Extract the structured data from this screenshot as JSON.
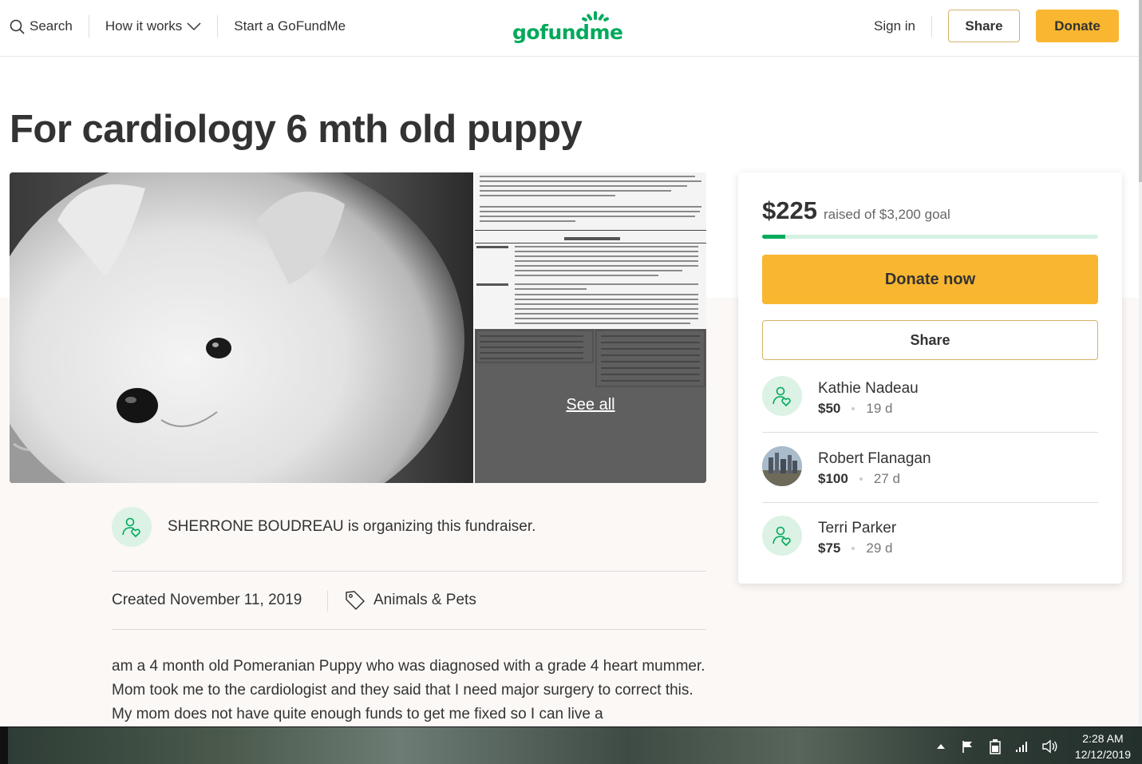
{
  "header": {
    "search_label": "Search",
    "how_it_works_label": "How it works",
    "start_label": "Start a GoFundMe",
    "logo_text": "gofundme",
    "sign_in_label": "Sign in",
    "share_label": "Share",
    "donate_label": "Donate"
  },
  "campaign": {
    "title": "For cardiology 6 mth old puppy",
    "see_all_label": "See all",
    "organizer_text": "SHERRONE BOUDREAU is organizing this fundraiser.",
    "created_text": "Created November 11, 2019",
    "category": "Animals & Pets",
    "story": "am a 4 month old Pomeranian Puppy who was diagnosed with a grade 4 heart mummer. Mom took me to the cardiologist and they said that I need major surgery to correct this. My mom does not have quite enough funds to get me fixed so I can live a"
  },
  "donation_card": {
    "raised_amount": "$225",
    "goal_text": "raised of $3,200 goal",
    "progress_fraction": 0.07,
    "donate_now_label": "Donate now",
    "share_label": "Share",
    "donors": [
      {
        "name": "Kathie Nadeau",
        "amount": "$50",
        "time": "19 d",
        "avatar": "donor-heart-icon"
      },
      {
        "name": "Robert Flanagan",
        "amount": "$100",
        "time": "27 d",
        "avatar": "photo"
      },
      {
        "name": "Terri Parker",
        "amount": "$75",
        "time": "29 d",
        "avatar": "donor-heart-icon"
      }
    ]
  },
  "taskbar": {
    "time": "2:28 AM",
    "date": "12/12/2019"
  },
  "colors": {
    "brand_green": "#02a95c",
    "donate_yellow": "#f9b630",
    "light_green": "#dbf2e4"
  }
}
